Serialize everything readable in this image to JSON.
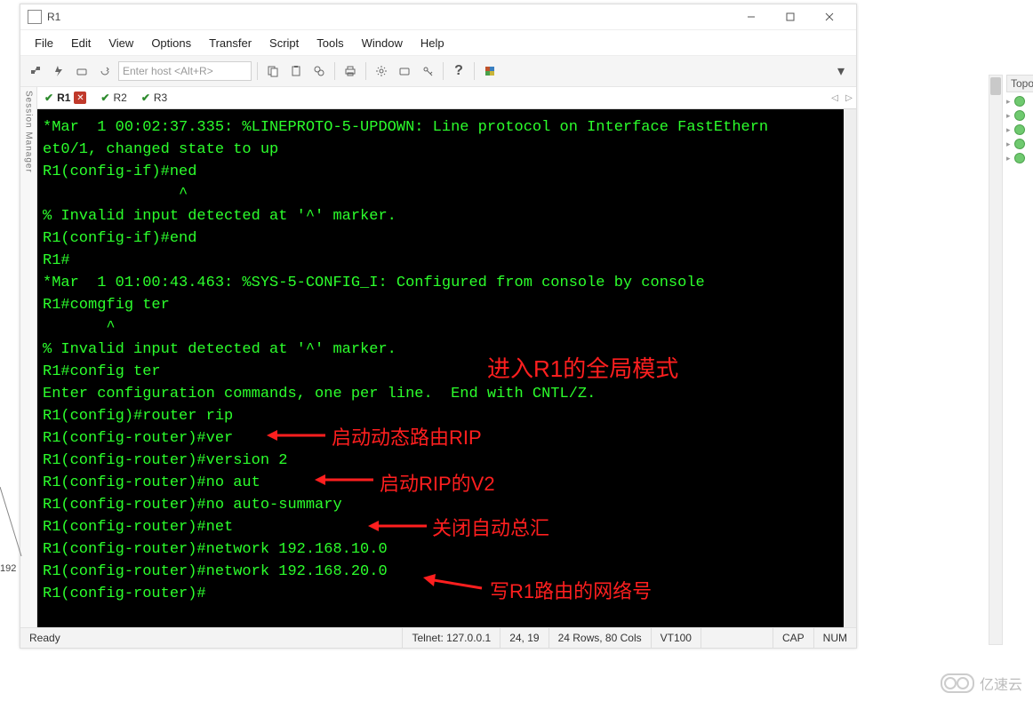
{
  "window": {
    "title": "R1",
    "min_tip": "Minimize",
    "max_tip": "Maximize",
    "close_tip": "Close"
  },
  "menu": {
    "file": "File",
    "edit": "Edit",
    "view": "View",
    "options": "Options",
    "transfer": "Transfer",
    "script": "Script",
    "tools": "Tools",
    "window": "Window",
    "help": "Help"
  },
  "toolbar": {
    "host_placeholder": "Enter host <Alt+R>",
    "dropdown_marker": "▾"
  },
  "side_panel": {
    "label": "Session Manager"
  },
  "tabs": {
    "items": [
      {
        "check": "✔",
        "label": "R1",
        "active": true,
        "closable": true
      },
      {
        "check": "✔",
        "label": "R2",
        "active": false
      },
      {
        "check": "✔",
        "label": "R3",
        "active": false
      }
    ],
    "prev": "◁",
    "next": "▷"
  },
  "terminal": {
    "lines": [
      "*Mar  1 00:02:37.335: %LINEPROTO-5-UPDOWN: Line protocol on Interface FastEthern",
      "et0/1, changed state to up",
      "R1(config-if)#ned",
      "               ^",
      "% Invalid input detected at '^' marker.",
      "",
      "R1(config-if)#end",
      "R1#",
      "*Mar  1 01:00:43.463: %SYS-5-CONFIG_I: Configured from console by console",
      "R1#comgfig ter",
      "       ^",
      "% Invalid input detected at '^' marker.",
      "",
      "R1#config ter",
      "Enter configuration commands, one per line.  End with CNTL/Z.",
      "R1(config)#router rip",
      "R1(config-router)#ver",
      "R1(config-router)#version 2",
      "R1(config-router)#no aut",
      "R1(config-router)#no auto-summary",
      "R1(config-router)#net",
      "R1(config-router)#network 192.168.10.0",
      "R1(config-router)#network 192.168.20.0",
      "R1(config-router)#"
    ]
  },
  "statusbar": {
    "ready": "Ready",
    "conn": "Telnet: 127.0.0.1",
    "pos": "24,  19",
    "size": "24 Rows, 80 Cols",
    "emu": "VT100",
    "cap": "CAP",
    "num": "NUM"
  },
  "annotations": {
    "a1": "进入R1的全局模式",
    "a2": "启动动态路由RIP",
    "a3": "启动RIP的V2",
    "a4": "关闭自动总汇",
    "a5": "写R1路由的网络号"
  },
  "topology": {
    "header": "Topol"
  },
  "crop_label": "192",
  "watermark": "亿速云"
}
